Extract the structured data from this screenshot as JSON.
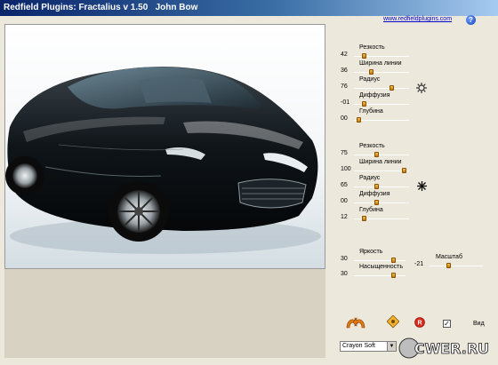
{
  "window": {
    "title": "Redfield Plugins: Fractalius v 1.50   John Bow"
  },
  "header": {
    "link_text": "www.redfieldplugins.com",
    "help_label": "?"
  },
  "group1": {
    "controls": [
      {
        "label": "Резкость",
        "value": "42",
        "position": 0.15
      },
      {
        "label": "Ширина линии",
        "value": "36",
        "position": 0.3
      },
      {
        "label": "Радиус",
        "value": "76",
        "position": 0.7
      },
      {
        "label": "Диффузия",
        "value": "-01",
        "position": 0.15
      },
      {
        "label": "Глубина",
        "value": "00",
        "position": 0.05
      }
    ]
  },
  "group2": {
    "controls": [
      {
        "label": "Резкость",
        "value": "75",
        "position": 0.4
      },
      {
        "label": "Ширина линии",
        "value": "100",
        "position": 0.95
      },
      {
        "label": "Радиус",
        "value": "65",
        "position": 0.4
      },
      {
        "label": "Диффузия",
        "value": "00",
        "position": 0.4
      },
      {
        "label": "Глубина",
        "value": "12",
        "position": 0.15
      }
    ]
  },
  "group3": {
    "controls": [
      {
        "label": "Яркость",
        "value": "30",
        "position": 0.8
      },
      {
        "label": "Насыщенность",
        "value": "30",
        "position": 0.8
      }
    ],
    "scale": {
      "label": "Масштаб",
      "value": "-21",
      "position": 0.35
    }
  },
  "bottom": {
    "preset_value": "Crayon Soft",
    "checkbox_label": "Вид",
    "checkbox_checked": "✓",
    "watermark_text": "CWER.RU"
  },
  "icons": {
    "gear1": "sun-gear-icon",
    "gear2": "starburst-icon",
    "undo": "undo-redo-arrows-icon",
    "random": "random-dice-icon",
    "reset": "reset-icon"
  },
  "colors": {
    "title_start": "#0a246a",
    "title_end": "#a6caf0",
    "panel_bg": "#ece8dc",
    "slider_thumb": "#e0a02a"
  }
}
